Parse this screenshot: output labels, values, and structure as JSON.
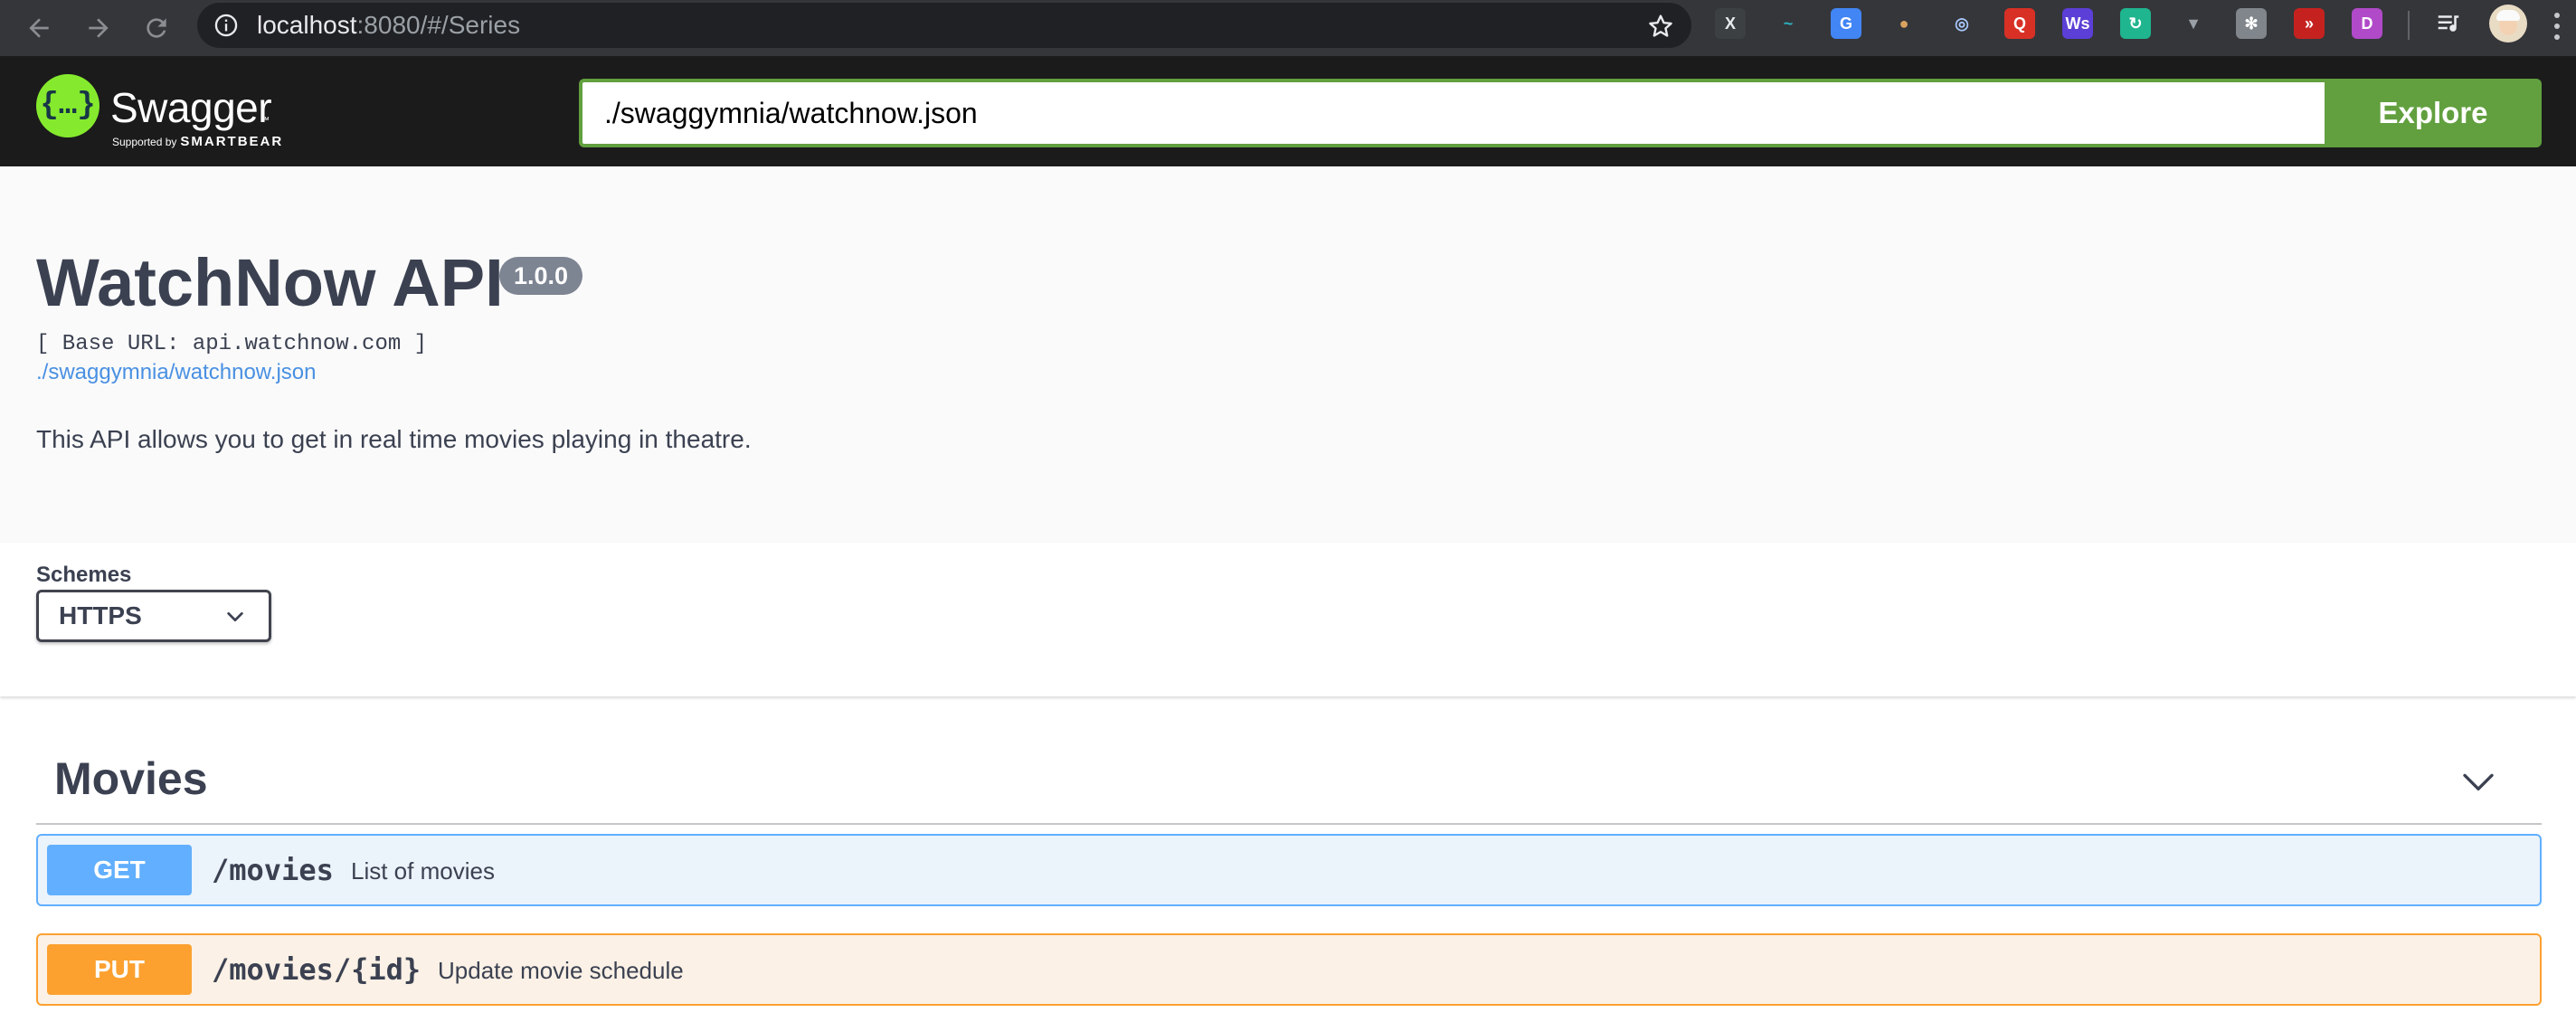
{
  "browser": {
    "url_host": "localhost",
    "url_rest": ":8080/#/Series",
    "extensions": [
      {
        "icon": "x-extension-icon",
        "glyph": "X",
        "bg": "#3c4043",
        "fg": "#e8eaed"
      },
      {
        "icon": "swirl-extension-icon",
        "glyph": "~",
        "bg": "transparent",
        "fg": "#2bb3c0"
      },
      {
        "icon": "google-translate-icon",
        "glyph": "G",
        "bg": "#4285f4",
        "fg": "#ffffff"
      },
      {
        "icon": "cookie-icon",
        "glyph": "●",
        "bg": "transparent",
        "fg": "#d9a25f"
      },
      {
        "icon": "ring-extension-icon",
        "glyph": "◎",
        "bg": "transparent",
        "fg": "#a8c7fa"
      },
      {
        "icon": "red-q-extension-icon",
        "glyph": "Q",
        "bg": "#d93025",
        "fg": "#ffffff"
      },
      {
        "icon": "ws-extension-icon",
        "glyph": "Ws",
        "bg": "#5b3fd6",
        "fg": "#ffffff"
      },
      {
        "icon": "refresh-green-extension-icon",
        "glyph": "↻",
        "bg": "#1fb58f",
        "fg": "#ffffff"
      },
      {
        "icon": "vue-devtools-icon",
        "glyph": "▼",
        "bg": "transparent",
        "fg": "#9aa0a6"
      },
      {
        "icon": "gray-gear-extension-icon",
        "glyph": "✻",
        "bg": "#80868b",
        "fg": "#ffffff"
      },
      {
        "icon": "red-forward-extension-icon",
        "glyph": "»",
        "bg": "#c5221f",
        "fg": "#ffffff"
      },
      {
        "icon": "d-extension-icon",
        "glyph": "D",
        "bg": "#b04ac8",
        "fg": "#ffffff"
      }
    ]
  },
  "topbar": {
    "logo_word": "Swagger",
    "logo_tm": "™",
    "logo_supported_by": "Supported by",
    "logo_company": "SMARTBEAR",
    "spec_url_value": "./swaggymnia/watchnow.json",
    "explore_label": "Explore",
    "accent_color": "#62a03f",
    "logo_color": "#85ea2d"
  },
  "info": {
    "title": "WatchNow API",
    "version": "1.0.0",
    "base_url": "[ Base URL: api.watchnow.com ]",
    "spec_link": "./swaggymnia/watchnow.json",
    "description": "This API allows you to get in real time movies playing in theatre."
  },
  "schemes": {
    "label": "Schemes",
    "selected": "HTTPS",
    "options": [
      "HTTPS"
    ]
  },
  "tags": [
    {
      "name": "Movies",
      "operations": [
        {
          "method": "GET",
          "path": "/movies",
          "summary": "List of movies",
          "color": "#61affe"
        },
        {
          "method": "PUT",
          "path": "/movies/{id}",
          "summary": "Update movie schedule",
          "color": "#fca130"
        }
      ]
    }
  ]
}
